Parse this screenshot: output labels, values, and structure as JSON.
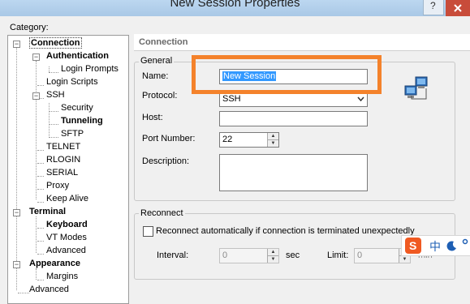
{
  "window": {
    "title": "New Session Properties"
  },
  "category_label": "Category:",
  "tree": {
    "connection": "Connection",
    "authentication": "Authentication",
    "login_prompts": "Login Prompts",
    "login_scripts": "Login Scripts",
    "ssh": "SSH",
    "security": "Security",
    "tunneling": "Tunneling",
    "sftp": "SFTP",
    "telnet": "TELNET",
    "rlogin": "RLOGIN",
    "serial": "SERIAL",
    "proxy": "Proxy",
    "keep_alive": "Keep Alive",
    "terminal": "Terminal",
    "keyboard": "Keyboard",
    "vt_modes": "VT Modes",
    "advanced_terminal": "Advanced",
    "appearance": "Appearance",
    "margins": "Margins",
    "advanced": "Advanced"
  },
  "panel": {
    "header": "Connection",
    "general": {
      "title": "General",
      "name_label": "Name:",
      "name_value": "New Session",
      "protocol_label": "Protocol:",
      "protocol_value": "SSH",
      "host_label": "Host:",
      "host_value": "",
      "port_label": "Port Number:",
      "port_value": "22",
      "description_label": "Description:",
      "description_value": ""
    },
    "reconnect": {
      "title": "Reconnect",
      "checkbox_label": "Reconnect automatically if connection is terminated unexpectedly",
      "interval_label": "Interval:",
      "interval_value": "0",
      "interval_unit": "sec",
      "limit_label": "Limit:",
      "limit_value": "0",
      "limit_unit": "min"
    }
  },
  "ime": {
    "logo": "S",
    "chinese_char": "中"
  },
  "colors": {
    "highlight": "#f4822b",
    "ime_logo": "#f05a22",
    "selection": "#3399ff"
  }
}
